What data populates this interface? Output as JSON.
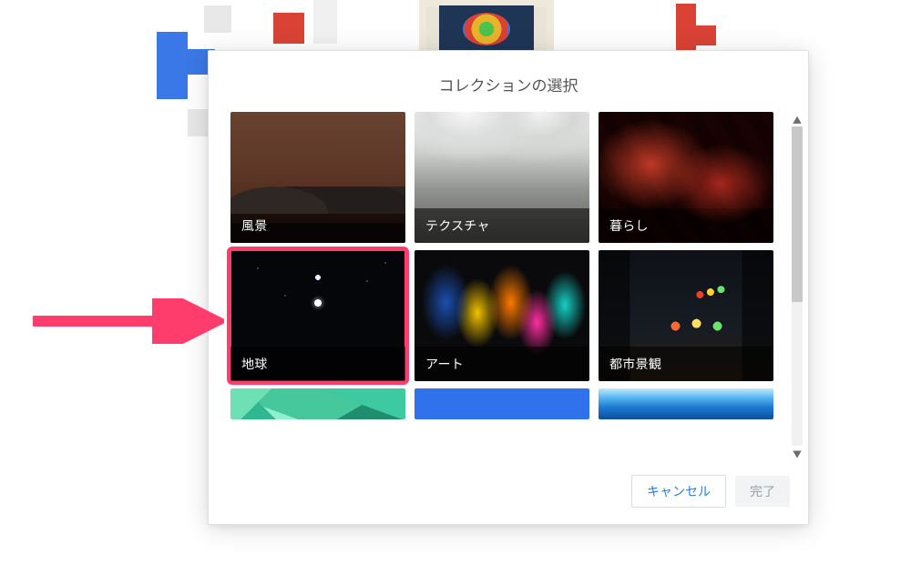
{
  "dialog": {
    "title": "コレクションの選択"
  },
  "tiles": [
    {
      "label": "風景"
    },
    {
      "label": "テクスチャ"
    },
    {
      "label": "暮らし"
    },
    {
      "label": "地球"
    },
    {
      "label": "アート"
    },
    {
      "label": "都市景観"
    }
  ],
  "buttons": {
    "cancel": "キャンセル",
    "done": "完了"
  },
  "colors": {
    "highlight": "#ff3d6d",
    "primary_link": "#2b7de1"
  }
}
